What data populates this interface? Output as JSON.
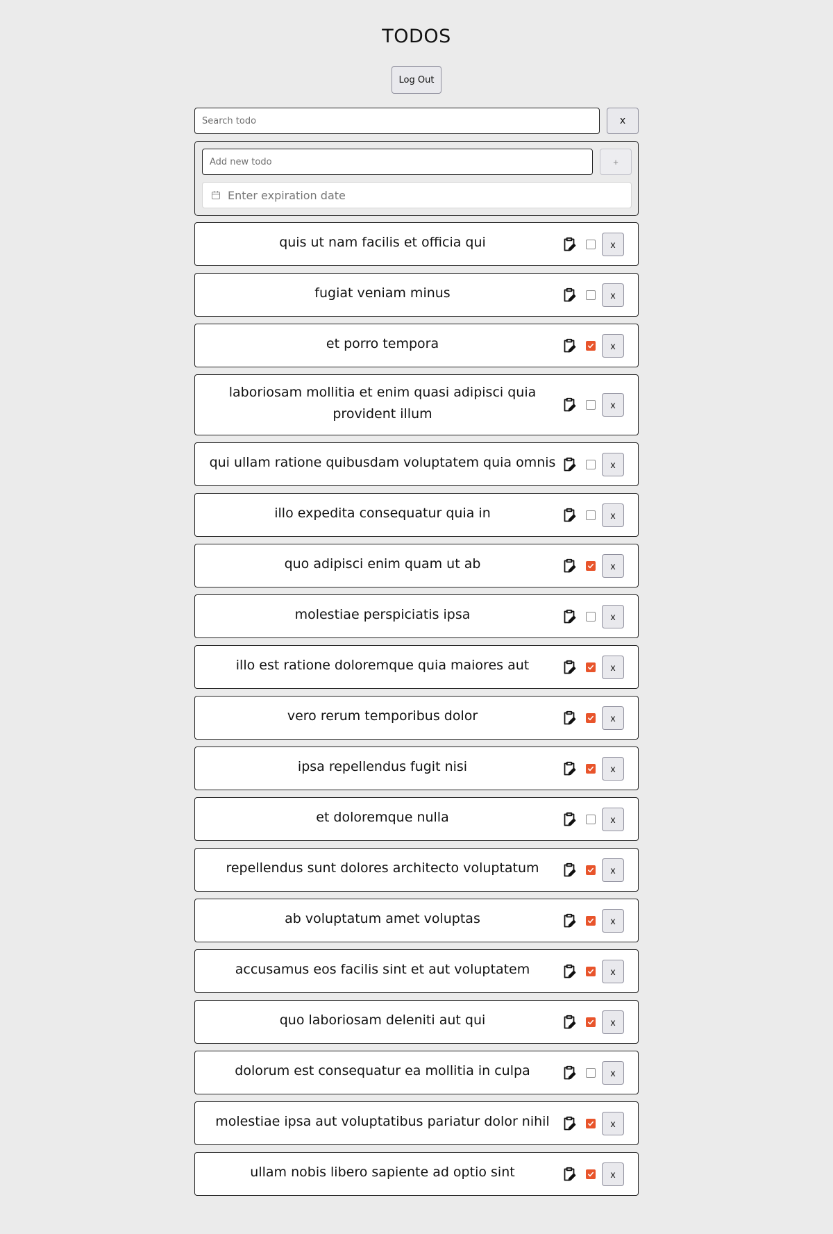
{
  "header": {
    "title": "TODOS",
    "logout_label": "Log Out"
  },
  "search": {
    "placeholder": "Search todo",
    "clear_label": "x"
  },
  "add_form": {
    "placeholder": "Add new todo",
    "add_label": "+",
    "date_placeholder": "Enter expiration date",
    "date_icon": "calendar-icon"
  },
  "todos": [
    {
      "text": "quis ut nam facilis et officia qui",
      "done": false
    },
    {
      "text": "fugiat veniam minus",
      "done": false
    },
    {
      "text": "et porro tempora",
      "done": true
    },
    {
      "text": "laboriosam mollitia et enim quasi adipisci quia provident illum",
      "done": false
    },
    {
      "text": "qui ullam ratione quibusdam voluptatem quia omnis",
      "done": false
    },
    {
      "text": "illo expedita consequatur quia in",
      "done": false
    },
    {
      "text": "quo adipisci enim quam ut ab",
      "done": true
    },
    {
      "text": "molestiae perspiciatis ipsa",
      "done": false
    },
    {
      "text": "illo est ratione doloremque quia maiores aut",
      "done": true
    },
    {
      "text": "vero rerum temporibus dolor",
      "done": true
    },
    {
      "text": "ipsa repellendus fugit nisi",
      "done": true
    },
    {
      "text": "et doloremque nulla",
      "done": false
    },
    {
      "text": "repellendus sunt dolores architecto voluptatum",
      "done": true
    },
    {
      "text": "ab voluptatum amet voluptas",
      "done": true
    },
    {
      "text": "accusamus eos facilis sint et aut voluptatem",
      "done": true
    },
    {
      "text": "quo laboriosam deleniti aut qui",
      "done": true
    },
    {
      "text": "dolorum est consequatur ea mollitia in culpa",
      "done": false
    },
    {
      "text": "molestiae ipsa aut voluptatibus pariatur dolor nihil",
      "done": true
    },
    {
      "text": "ullam nobis libero sapiente ad optio sint",
      "done": true
    }
  ],
  "todo_actions": {
    "edit_icon": "clipboard-edit-icon",
    "delete_label": "x"
  },
  "colors": {
    "accent": "#e8542b",
    "background": "#ebebeb"
  }
}
